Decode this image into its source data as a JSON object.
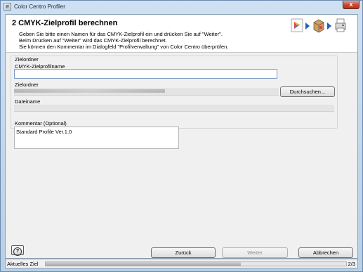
{
  "window": {
    "title": "Color Centro Profiler",
    "close_glyph": "x"
  },
  "header": {
    "step_title": "2 CMYK-Zielprofil berechnen",
    "instructions": [
      "Geben Sie bitte einen Namen für das CMYK-Zielprofil ein und drücken Sie auf \"Weiter\".",
      "Beim Drücken auf \"Weiter\" wird das CMYK-Zielprofil berechnet.",
      "Sie können den Kommentar im Dialogfeld \"Profilverwaltung\" von Color Centro überprüfen."
    ],
    "icons": [
      "color-wheel-icon",
      "arrow-icon",
      "box-icon",
      "arrow-icon",
      "printer-icon"
    ]
  },
  "form": {
    "group_label": "Zielordner",
    "profile_name_label": "CMYK-Zielprofilname",
    "profile_name_value": "",
    "folder_label": "Zielordner",
    "browse_label": "Durchsuchen...",
    "filename_label": "Dateiname",
    "comment_label": "Kommentar (Optional)",
    "comment_value": "Standard Profile Ver.1.0"
  },
  "buttons": {
    "help": "?",
    "back": "Zurück",
    "next": "Weiter",
    "cancel": "Abbrechen"
  },
  "status": {
    "label": "Aktuelles Ziel",
    "progress_fraction": 0.65,
    "page": "2/3"
  },
  "colors": {
    "accent": "#1f5fc8",
    "frame": "#b9cfe6"
  }
}
